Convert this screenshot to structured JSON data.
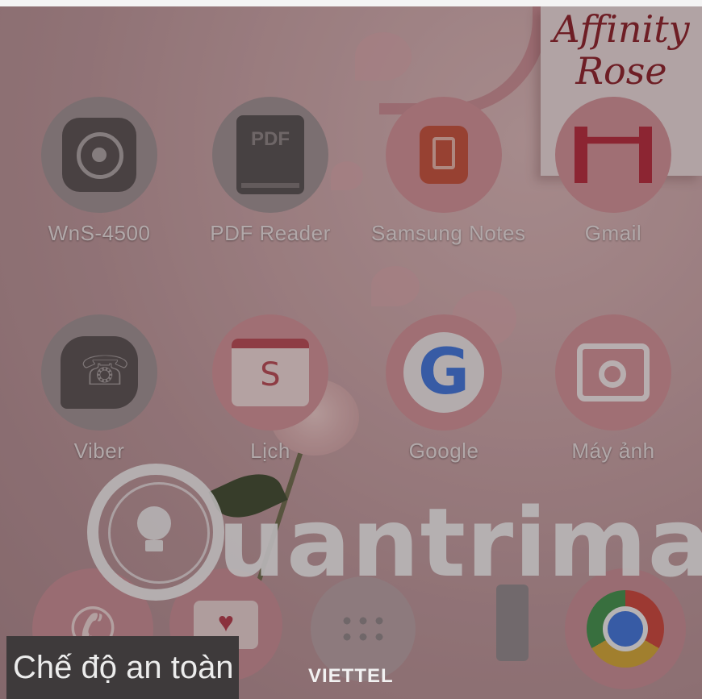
{
  "card": {
    "text_line1": "Affinity",
    "text_line2": "Rose"
  },
  "apps": [
    {
      "label": "WnS-4500",
      "icon": "camera-lens-icon"
    },
    {
      "label": "PDF Reader",
      "icon": "pdf-book-icon",
      "icon_text": "PDF"
    },
    {
      "label": "Samsung Notes",
      "icon": "notes-icon"
    },
    {
      "label": "Gmail",
      "icon": "gmail-icon"
    },
    {
      "label": "Viber",
      "icon": "viber-icon"
    },
    {
      "label": "Lịch",
      "icon": "calendar-icon",
      "icon_text": "S"
    },
    {
      "label": "Google",
      "icon": "google-icon",
      "icon_text": "G"
    },
    {
      "label": "Máy ảnh",
      "icon": "camera-icon"
    }
  ],
  "dock": [
    "phone-icon",
    "messages-icon",
    "app-drawer-icon",
    "chrome-icon"
  ],
  "watermark": {
    "text": "uantrimang"
  },
  "status": {
    "safe_mode": "Chế độ an toàn",
    "carrier": "VIETTEL"
  }
}
